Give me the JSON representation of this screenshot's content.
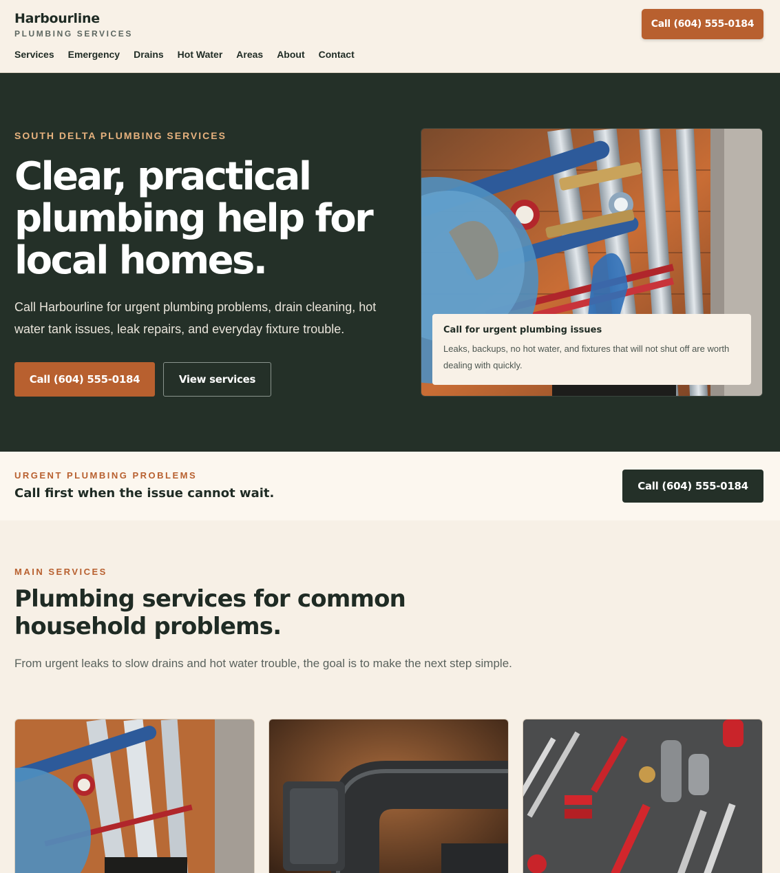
{
  "header": {
    "brand_name": "Harbourline",
    "brand_sub": "PLUMBING SERVICES",
    "nav": [
      "Services",
      "Emergency",
      "Drains",
      "Hot Water",
      "Areas",
      "About",
      "Contact"
    ],
    "cta": "Call (604) 555-0184"
  },
  "hero": {
    "eyebrow": "SOUTH DELTA PLUMBING SERVICES",
    "title": "Clear, practical plumbing help for local homes.",
    "text": "Call Harbourline for urgent plumbing problems, drain cleaning, hot water tank issues, leak repairs, and everyday fixture trouble.",
    "primary_button": "Call (604) 555-0184",
    "secondary_button": "View services",
    "card_title": "Call for urgent plumbing issues",
    "card_text": "Leaks, backups, no hot water, and fixtures that will not shut off are worth dealing with quickly."
  },
  "urgent": {
    "eyebrow": "URGENT PLUMBING PROBLEMS",
    "title": "Call first when the issue cannot wait.",
    "cta": "Call (604) 555-0184"
  },
  "services": {
    "eyebrow": "MAIN SERVICES",
    "title": "Plumbing services for common household problems.",
    "text": "From urgent leaks to slow drains and hot water trouble, the goal is to make the next step simple."
  },
  "colors": {
    "accent": "#b8602f",
    "dark": "#243028",
    "cream": "#f7f0e6"
  }
}
